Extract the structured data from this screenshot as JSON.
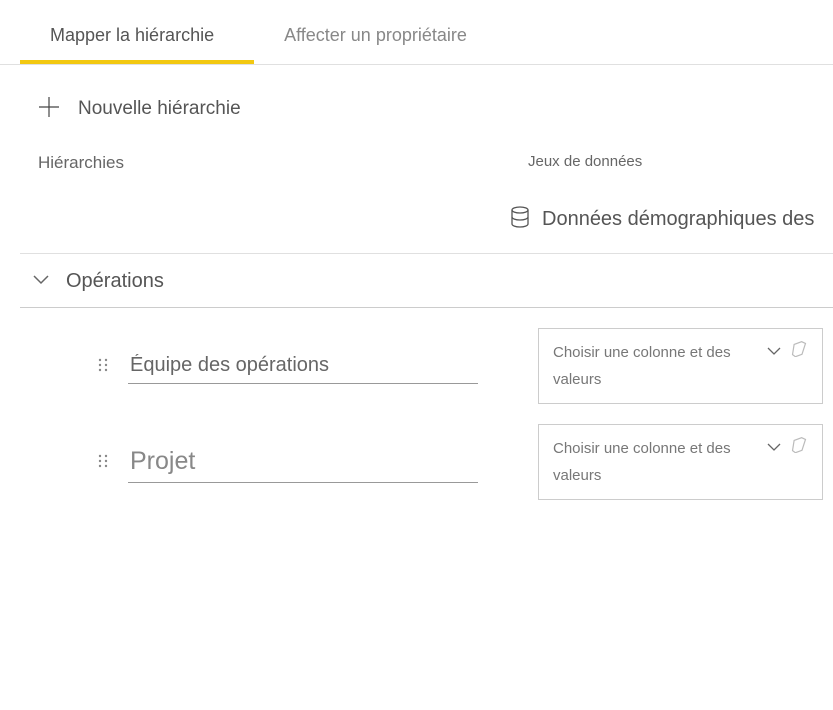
{
  "tabs": {
    "active": "Mapper la hiérarchie",
    "inactive": "Affecter un propriétaire"
  },
  "newHierarchy": {
    "label": "Nouvelle hiérarchie"
  },
  "sectionHeaders": {
    "left": "Hiérarchies",
    "right": "Jeux de données"
  },
  "dataset": {
    "name": "Données démographiques des"
  },
  "group": {
    "name": "Opérations"
  },
  "levels": [
    {
      "value": "Équipe des opérations",
      "selector": "Choisir une colonne et des valeurs"
    },
    {
      "value": "Projet",
      "selector": "Choisir une colonne et des valeurs"
    }
  ]
}
